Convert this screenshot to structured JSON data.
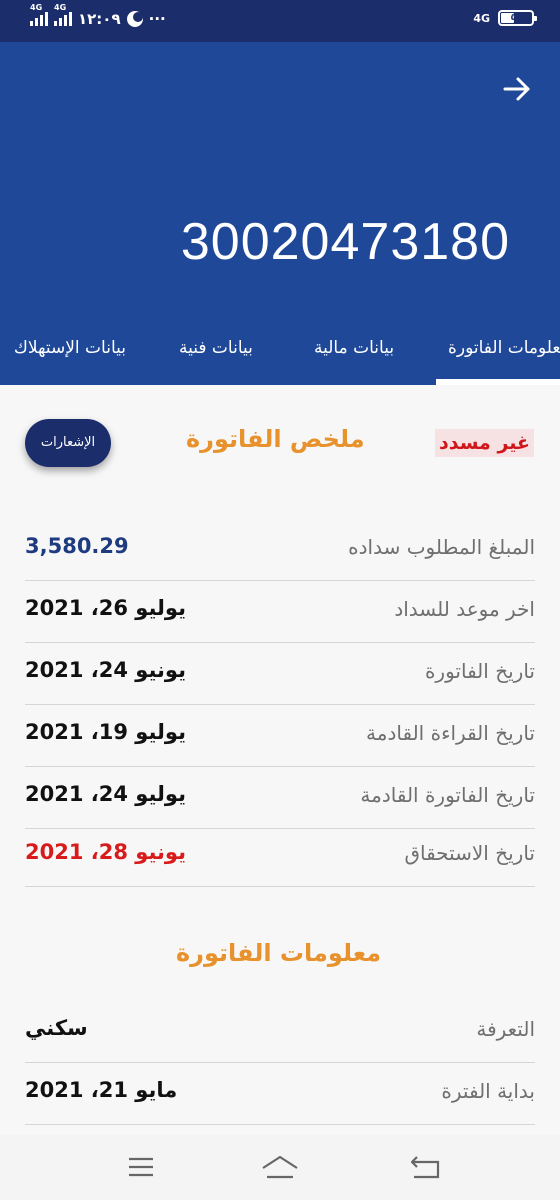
{
  "status_bar": {
    "net1": "4G",
    "net2": "4G",
    "time": "١٢:٠٩",
    "more": "···",
    "net_right": "4G",
    "battery": "٥٧"
  },
  "header": {
    "account_number": "30020473180"
  },
  "tabs": [
    {
      "label": "معلومات الفاتورة",
      "active": true
    },
    {
      "label": "بيانات مالية",
      "active": false
    },
    {
      "label": "بيانات فنية",
      "active": false
    },
    {
      "label": "بيانات الإستهلاك",
      "active": false
    }
  ],
  "summary": {
    "title": "ملخص الفاتورة",
    "status": "غير مسدد",
    "notifications_label": "الإشعارات",
    "rows": [
      {
        "label": "المبلغ المطلوب سداده",
        "value": "3,580.29"
      },
      {
        "label": "اخر موعد للسداد",
        "value": "يوليو 26، 2021"
      },
      {
        "label": "تاريخ الفاتورة",
        "value": "يونيو 24، 2021"
      },
      {
        "label": "تاريخ القراءة القادمة",
        "value": "يوليو 19، 2021"
      },
      {
        "label": "تاريخ الفاتورة القادمة",
        "value": "يوليو 24، 2021"
      },
      {
        "label": "تاريخ الاستحقاق",
        "value": "يونيو 28، 2021"
      }
    ]
  },
  "info": {
    "title": "معلومات الفاتورة",
    "rows": [
      {
        "label": "التعرفة",
        "value": "سكني"
      },
      {
        "label": "بداية الفترة",
        "value": "مايو 21، 2021"
      }
    ]
  },
  "colors": {
    "header": "#1f4898",
    "status_bar": "#1c2d6b",
    "accent_orange": "#e8922d",
    "amount_blue": "#1f3b80",
    "overdue_red": "#d81a1a"
  }
}
